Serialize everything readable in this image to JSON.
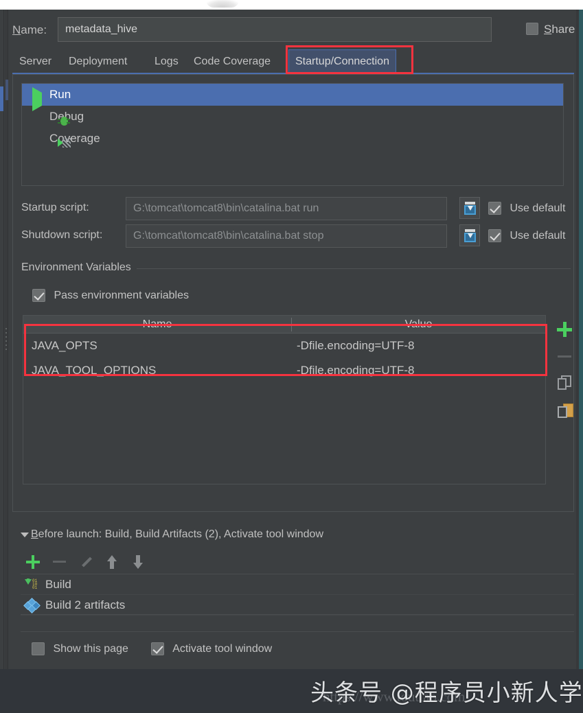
{
  "window": {
    "name_label": "Name:",
    "name_value": "metadata_hive",
    "share_label": "Share"
  },
  "tabs": [
    {
      "label": "Server",
      "selected": false
    },
    {
      "label": "Deployment",
      "selected": false
    },
    {
      "label": "Logs",
      "selected": false
    },
    {
      "label": "Code Coverage",
      "selected": false
    },
    {
      "label": "Startup/Connection",
      "selected": true
    }
  ],
  "modes": [
    {
      "label": "Run",
      "icon": "run-icon",
      "selected": true
    },
    {
      "label": "Debug",
      "icon": "debug-icon",
      "selected": false
    },
    {
      "label": "Coverage",
      "icon": "coverage-icon",
      "selected": false
    }
  ],
  "scripts": {
    "startup": {
      "label": "Startup script:",
      "value": "G:\\tomcat\\tomcat8\\bin\\catalina.bat run",
      "use_default_label": "Use default",
      "use_default_checked": true
    },
    "shutdown": {
      "label": "Shutdown script:",
      "value": "G:\\tomcat\\tomcat8\\bin\\catalina.bat stop",
      "use_default_label": "Use default",
      "use_default_checked": true
    }
  },
  "env": {
    "section_title": "Environment Variables",
    "pass_label": "Pass environment variables",
    "pass_checked": true,
    "columns": [
      "Name",
      "Value"
    ],
    "rows": [
      {
        "name": "JAVA_OPTS",
        "value": "-Dfile.encoding=UTF-8"
      },
      {
        "name": "JAVA_TOOL_OPTIONS",
        "value": "-Dfile.encoding=UTF-8"
      }
    ],
    "tools": [
      "add-icon",
      "remove-icon",
      "copy-icon",
      "paste-icon"
    ]
  },
  "before_launch": {
    "header": "Before launch: Build, Build Artifacts (2), Activate tool window",
    "header_first_letter": "B",
    "header_rest": "efore launch: Build, Build Artifacts (2), Activate tool window",
    "tools": [
      "add-icon",
      "remove-icon",
      "edit-icon",
      "move-up-icon",
      "move-down-icon"
    ],
    "items": [
      {
        "label": "Build",
        "icon": "build-icon"
      },
      {
        "label": "Build 2 artifacts",
        "icon": "artifacts-icon"
      }
    ]
  },
  "bottom": {
    "show_page_label": "Show this page",
    "show_page_checked": false,
    "activate_tool_window_label": "Activate tool window",
    "activate_tool_window_checked": true
  },
  "watermark": {
    "text": "头条号 @程序员小新人学习",
    "ghost": "https://www.toutiao.com"
  },
  "colors": {
    "accent_blue": "#4b6eaf",
    "annotation_red": "#f5333f",
    "green": "#4bcf5f",
    "panel_bg": "#3c3f41",
    "teal_edge": "#2f5a60"
  }
}
